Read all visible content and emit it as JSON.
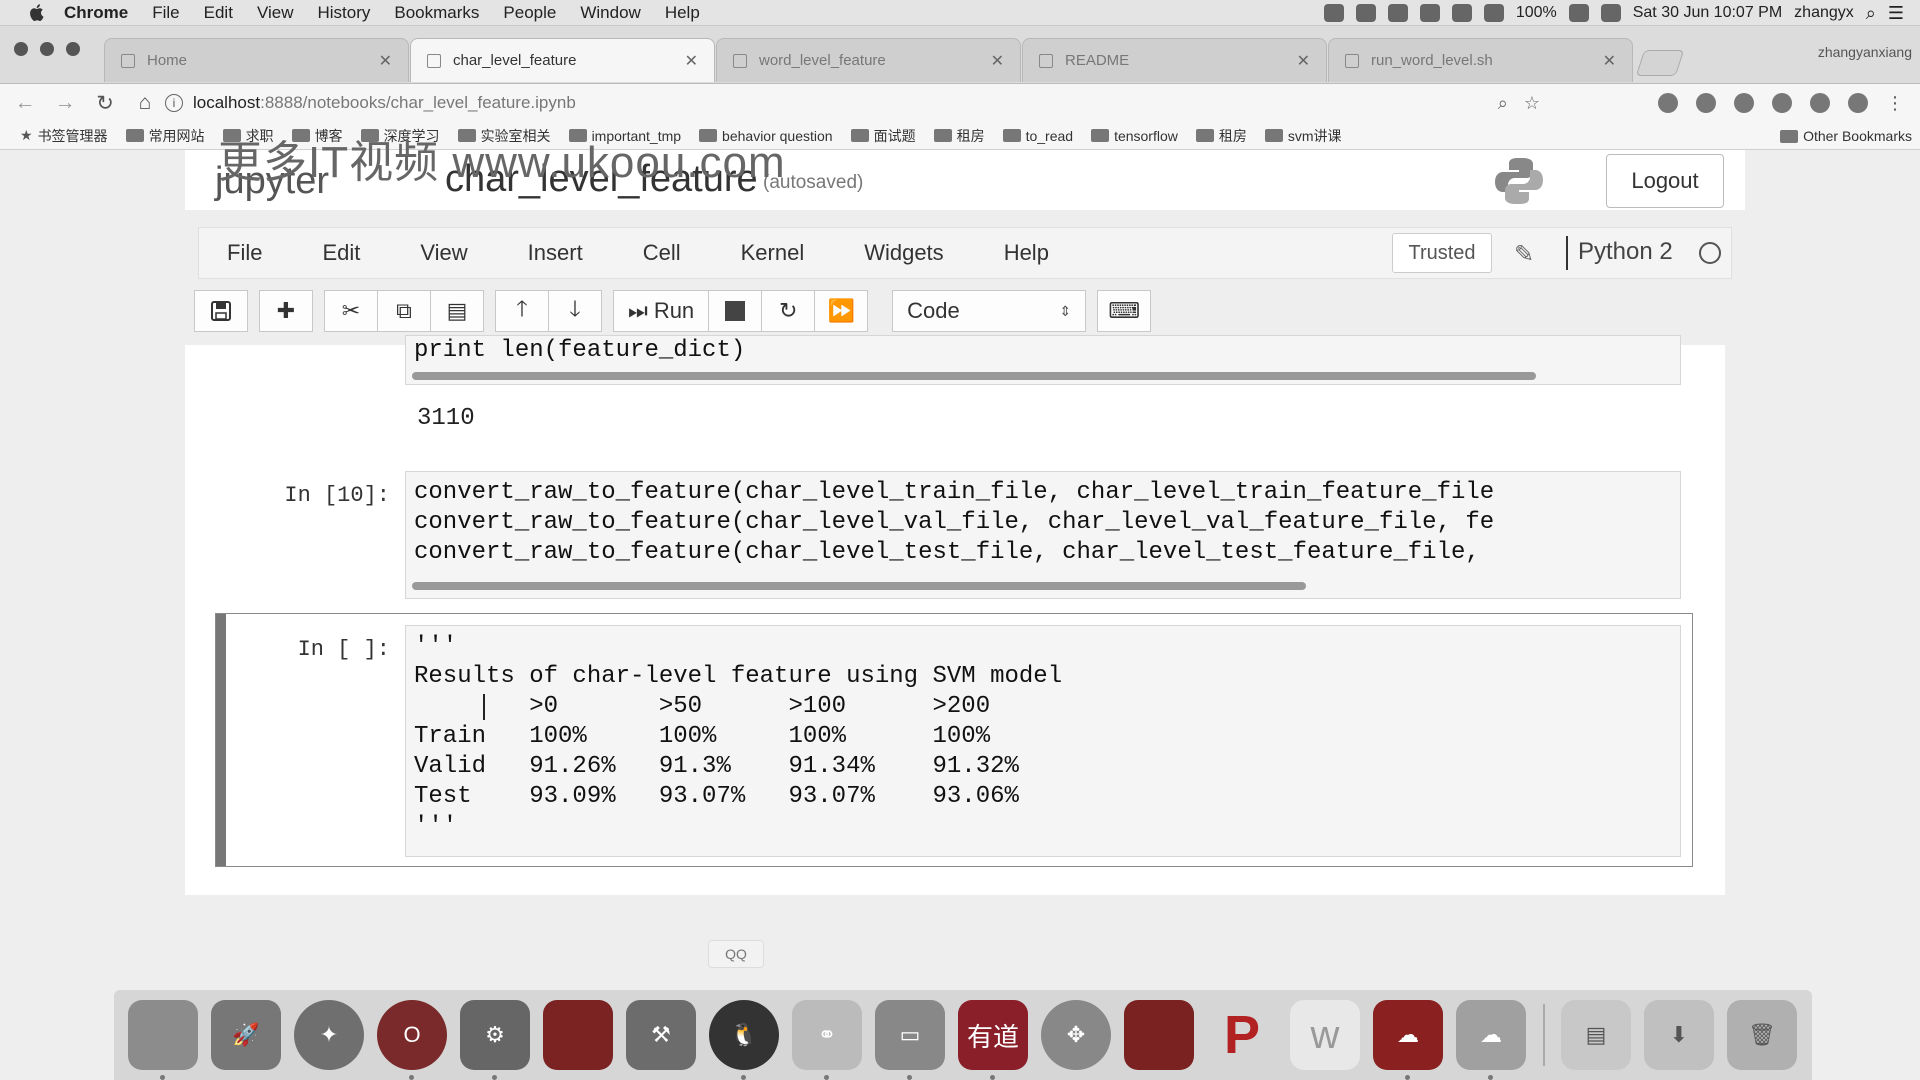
{
  "os_menubar": {
    "app_name": "Chrome",
    "menus": [
      "File",
      "Edit",
      "View",
      "History",
      "Bookmarks",
      "People",
      "Window",
      "Help"
    ],
    "battery": "100%",
    "clock": "Sat 30 Jun  10:07 PM",
    "user": "zhangyx"
  },
  "browser": {
    "tabs": [
      {
        "label": "Home",
        "active": false
      },
      {
        "label": "char_level_feature",
        "active": true
      },
      {
        "label": "word_level_feature",
        "active": false
      },
      {
        "label": "README",
        "active": false
      },
      {
        "label": "run_word_level.sh",
        "active": false
      }
    ],
    "profile_name": "zhangyanxiang",
    "url_host": "localhost",
    "url_path": ":8888/notebooks/char_level_feature.ipynb",
    "bookmarks": [
      "书签管理器",
      "常用网站",
      "求职",
      "博客",
      "深度学习",
      "实验室相关",
      "important_tmp",
      "behavior question",
      "面试题",
      "租房",
      "to_read",
      "tensorflow",
      "租房",
      "svm讲课"
    ],
    "other_bookmarks": "Other Bookmarks"
  },
  "watermark": "更多IT视频 www.ukoou.com",
  "jupyter": {
    "logo_text": "jupyter",
    "notebook_name": "char_level_feature",
    "save_status": "(autosaved)",
    "logout_label": "Logout",
    "menu": [
      "File",
      "Edit",
      "View",
      "Insert",
      "Cell",
      "Kernel",
      "Widgets",
      "Help"
    ],
    "trusted_label": "Trusted",
    "kernel_name": "Python 2",
    "toolbar": {
      "run_label": "Run",
      "cell_type": "Code"
    }
  },
  "cells": {
    "prev_code_tail": "print len(feature_dict)",
    "prev_output": "3110",
    "cell10": {
      "prompt": "In [10]:",
      "lines": [
        "convert_raw_to_feature(char_level_train_file, char_level_train_feature_file",
        "convert_raw_to_feature(char_level_val_file, char_level_val_feature_file, fe",
        "convert_raw_to_feature(char_level_test_file, char_level_test_feature_file,"
      ]
    },
    "current": {
      "prompt": "In [ ]:",
      "lines": [
        "'''",
        "Results of char-level feature using SVM model",
        "        >0       >50      >100      >200",
        "Train   100%     100%     100%      100%",
        "Valid   91.26%   91.3%    91.34%    91.32%",
        "Test    93.09%   93.07%   93.07%    93.06%",
        "'''"
      ]
    }
  },
  "dock_tooltip": "QQ",
  "dock_apps": [
    {
      "name": "Finder",
      "color": "#8c8c8c"
    },
    {
      "name": "Launchpad",
      "color": "#777777"
    },
    {
      "name": "Safari",
      "color": "#6f6f6f"
    },
    {
      "name": "Opera",
      "color": "#7a2a2a"
    },
    {
      "name": "System Preferences",
      "color": "#666666"
    },
    {
      "name": "Terminal-like",
      "color": "#7b2222"
    },
    {
      "name": "Xcode-like",
      "color": "#6c6c6c"
    },
    {
      "name": "QQ",
      "color": "#333333"
    },
    {
      "name": "Sync",
      "color": "#bbbbbb"
    },
    {
      "name": "Preview",
      "color": "#888888"
    },
    {
      "name": "Youdao",
      "color": "#8a1f2a",
      "label": "有道"
    },
    {
      "name": "Crossover",
      "color": "#888888"
    },
    {
      "name": "App",
      "color": "#7a2222"
    },
    {
      "name": "P app",
      "color": "#b22222"
    },
    {
      "name": "W app",
      "color": "#dddddd"
    },
    {
      "name": "Remote",
      "color": "#8a2020"
    },
    {
      "name": "Cloud",
      "color": "#a0a0a0"
    },
    {
      "name": "Documents",
      "color": "#c8c8c8"
    },
    {
      "name": "Downloads",
      "color": "#c0c0c0"
    },
    {
      "name": "Trash",
      "color": "#b0b0b0"
    }
  ]
}
